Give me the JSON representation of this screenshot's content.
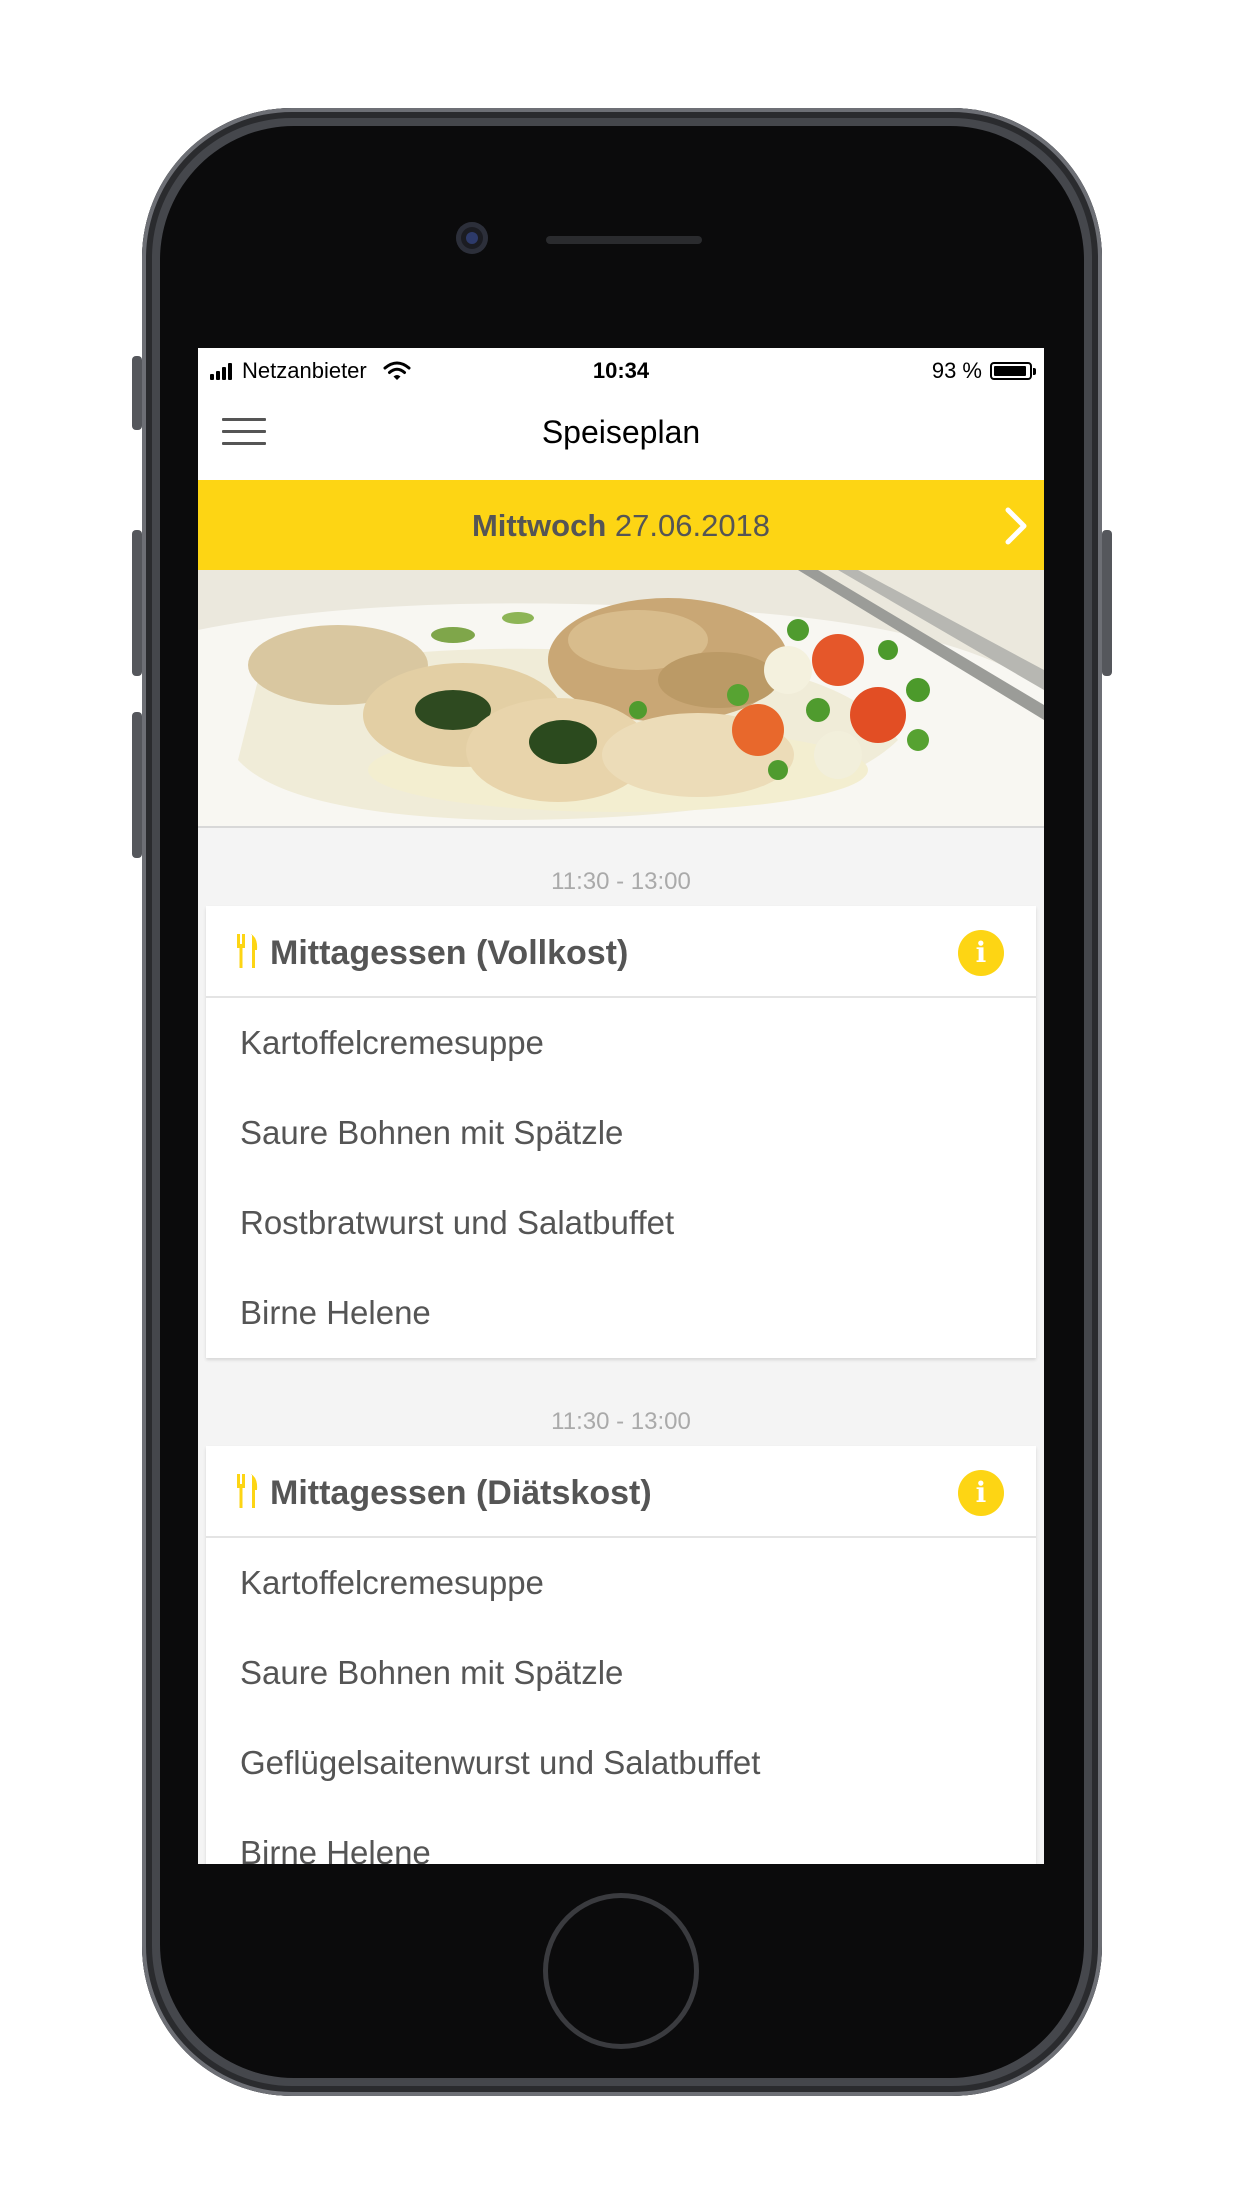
{
  "status_bar": {
    "carrier": "Netzanbieter",
    "time": "10:34",
    "battery_text": "93 %",
    "battery_level": 0.93
  },
  "nav": {
    "title": "Speiseplan",
    "menu_icon": "hamburger-menu-icon"
  },
  "date_bar": {
    "weekday": "Mittwoch",
    "date": "27.06.2018",
    "next_icon": "chevron-right-icon",
    "background_color": "#fdd514"
  },
  "meals": [
    {
      "time": "11:30 - 13:00",
      "title": "Mittagessen (Vollkost)",
      "icon": "cutlery-icon",
      "info_icon": "info-icon",
      "items": [
        "Kartoffelcremesuppe",
        "Saure Bohnen mit Spätzle",
        "Rostbratwurst und Salatbuffet",
        "Birne Helene"
      ]
    },
    {
      "time": "11:30 - 13:00",
      "title": "Mittagessen (Diätskost)",
      "icon": "cutlery-icon",
      "info_icon": "info-icon",
      "items": [
        "Kartoffelcremesuppe",
        "Saure Bohnen mit Spätzle",
        "Geflügelsaitenwurst und Salatbuffet",
        "Birne Helene"
      ]
    }
  ],
  "colors": {
    "accent": "#fdd514",
    "text": "#555555",
    "muted": "#aaaaaa"
  }
}
